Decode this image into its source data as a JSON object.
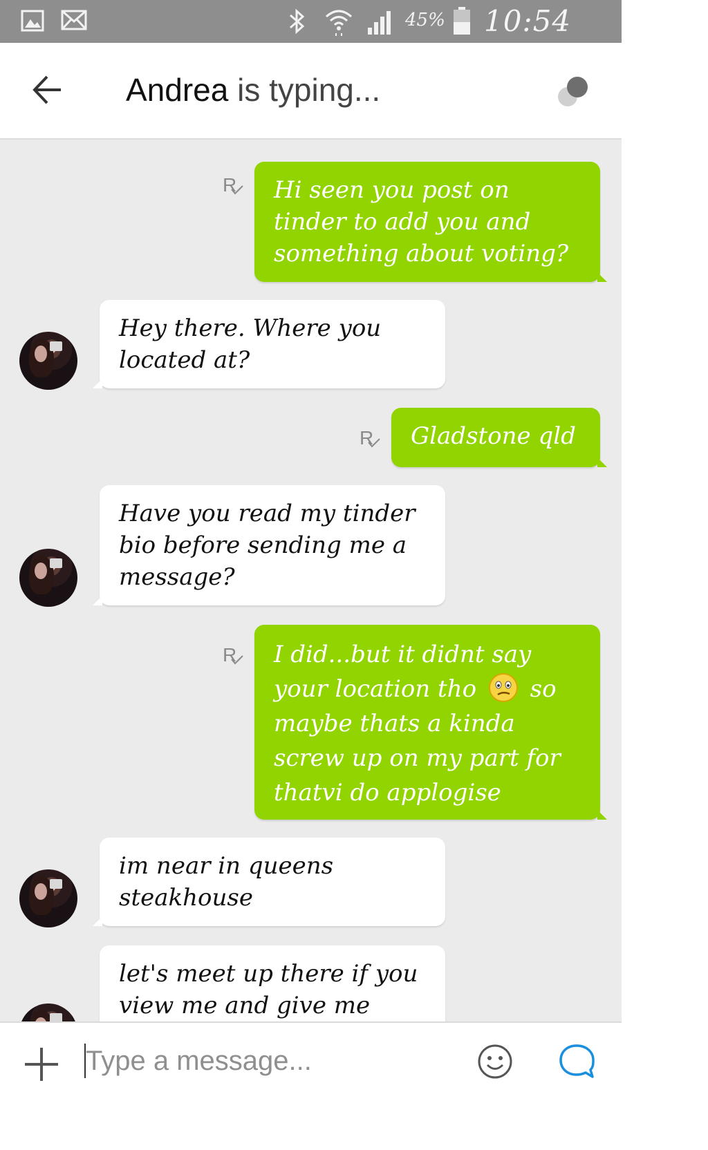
{
  "status_bar": {
    "battery_percent": "45%",
    "time": "10:54 pm",
    "icons": [
      "gallery-icon",
      "mail-icon",
      "bluetooth-icon",
      "wifi-icon",
      "signal-icon",
      "battery-icon"
    ]
  },
  "header": {
    "contact_name": "Andrea",
    "status_text": " is typing...",
    "back_icon": "arrow-left-icon",
    "presence_icon": "presence-dots-icon"
  },
  "messages": [
    {
      "direction": "out",
      "text": "Hi seen you post on tinder to add you and something about voting?",
      "receipt": "R"
    },
    {
      "direction": "in",
      "text": "Hey there. Where you located at?"
    },
    {
      "direction": "out",
      "text": "Gladstone qld",
      "receipt": "R"
    },
    {
      "direction": "in",
      "text": "Have you read my tinder bio before sending me a message?"
    },
    {
      "direction": "out",
      "text_before_emoji": "I did...but it didnt say your location tho",
      "emoji": "confused-face-emoji",
      "text_after_emoji": "so maybe thats a kinda screw up on my part for thatvi do applogise",
      "receipt": "R"
    },
    {
      "direction": "in",
      "text": "im near in queens steakhouse"
    },
    {
      "direction": "in",
      "text": "let's meet up there if you view me and give me"
    }
  ],
  "composer": {
    "placeholder": "Type a message...",
    "value": "",
    "icons": [
      "plus-icon",
      "smiley-icon",
      "send-chat-icon"
    ]
  },
  "colors": {
    "status_bar": "#8e8e8e",
    "outgoing_bubble": "#92d400",
    "incoming_bubble": "#ffffff",
    "chat_background": "#ebebeb",
    "accent_blue": "#1a8fe0"
  }
}
